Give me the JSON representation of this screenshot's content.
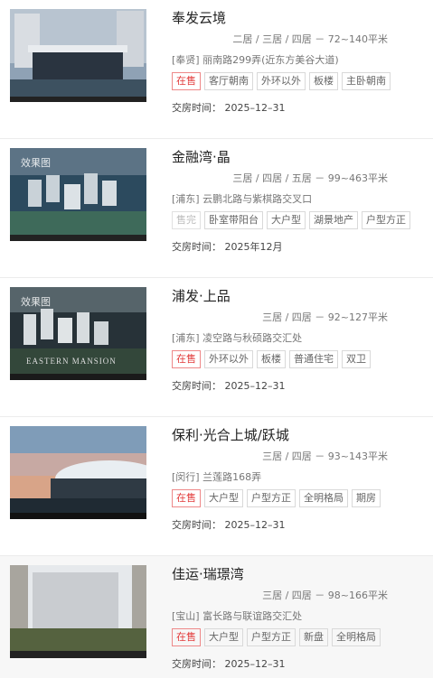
{
  "items": [
    {
      "title": "奉发云境",
      "rooms": "二居 / 三居 / 四居",
      "area": "－ 72~140平米",
      "address": "[奉贤] 丽南路299弄(近东方美谷大道)",
      "tags": [
        "在售",
        "客厅朝南",
        "外环以外",
        "板楼",
        "主卧朝南"
      ],
      "delivery": "交房时间：  2025–12–31"
    },
    {
      "title": "金融湾·晶",
      "image_tag": "效果图",
      "rooms": "三居 / 四居 / 五居",
      "area": "－ 99~463平米",
      "address": "[浦东] 云鹏北路与紫棋路交叉口",
      "tags": [
        "售完",
        "卧室带阳台",
        "大户型",
        "湖景地产",
        "户型方正"
      ],
      "delivery": "交房时间：  2025年12月"
    },
    {
      "title": "浦发·上品",
      "image_tag": "效果图",
      "rooms": "三居 / 四居",
      "area": "－ 92~127平米",
      "address": "[浦东] 凌空路与秋硕路交汇处",
      "tags": [
        "在售",
        "外环以外",
        "板楼",
        "普通住宅",
        "双卫"
      ],
      "delivery": "交房时间：  2025–12–31",
      "image_caption": "EASTERN MANSION"
    },
    {
      "title": "保利·光合上城/跃城",
      "rooms": "三居 / 四居",
      "area": "－ 93~143平米",
      "address": "[闵行] 兰莲路168弄",
      "tags": [
        "在售",
        "大户型",
        "户型方正",
        "全明格局",
        "期房"
      ],
      "delivery": "交房时间：  2025–12–31"
    },
    {
      "title": "佳运·瑞璟湾",
      "rooms": "三居 / 四居",
      "area": "－ 98~166平米",
      "address": "[宝山] 富长路与联谊路交汇处",
      "tags": [
        "在售",
        "大户型",
        "户型方正",
        "新盘",
        "全明格局"
      ],
      "delivery": "交房时间：  2025–12–31"
    }
  ],
  "colors": {
    "onsale": "#e23b3b",
    "soldout": "#bbbbbb",
    "border": "#ececec"
  }
}
